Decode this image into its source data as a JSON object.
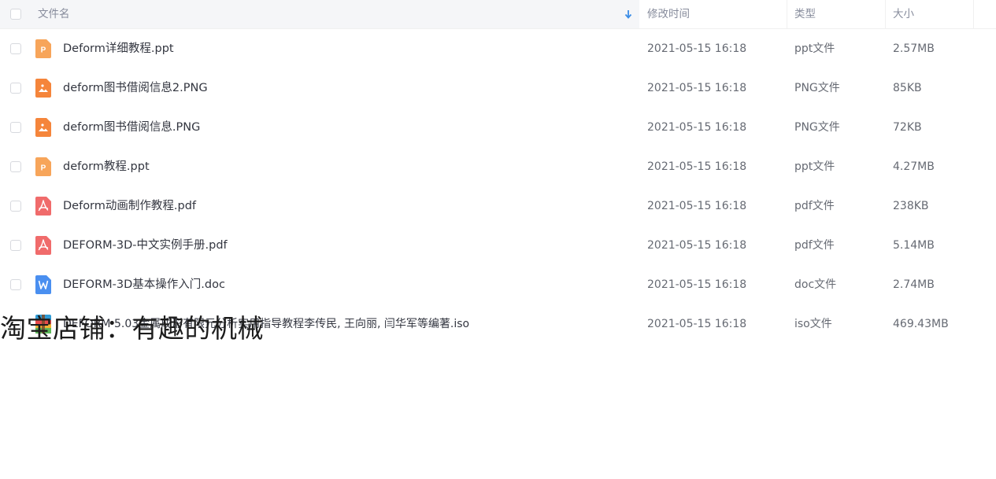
{
  "header": {
    "name_label": "文件名",
    "modified_label": "修改时间",
    "type_label": "类型",
    "size_label": "大小"
  },
  "files": [
    {
      "name": "Deform详细教程.ppt",
      "modified": "2021-05-15 16:18",
      "type": "ppt文件",
      "size": "2.57MB",
      "icon": "ppt-file-icon",
      "icon_color": "#f7a55a"
    },
    {
      "name": "deform图书借阅信息2.PNG",
      "modified": "2021-05-15 16:18",
      "type": "PNG文件",
      "size": "85KB",
      "icon": "image-file-icon",
      "icon_color": "#f5853b"
    },
    {
      "name": "deform图书借阅信息.PNG",
      "modified": "2021-05-15 16:18",
      "type": "PNG文件",
      "size": "72KB",
      "icon": "image-file-icon",
      "icon_color": "#f5853b"
    },
    {
      "name": "deform教程.ppt",
      "modified": "2021-05-15 16:18",
      "type": "ppt文件",
      "size": "4.27MB",
      "icon": "ppt-file-icon",
      "icon_color": "#f7a55a"
    },
    {
      "name": "Deform动画制作教程.pdf",
      "modified": "2021-05-15 16:18",
      "type": "pdf文件",
      "size": "238KB",
      "icon": "pdf-file-icon",
      "icon_color": "#f06b6b"
    },
    {
      "name": "DEFORM-3D-中文实例手册.pdf",
      "modified": "2021-05-15 16:18",
      "type": "pdf文件",
      "size": "5.14MB",
      "icon": "pdf-file-icon",
      "icon_color": "#f06b6b"
    },
    {
      "name": "DEFORM-3D基本操作入门.doc",
      "modified": "2021-05-15 16:18",
      "type": "doc文件",
      "size": "2.74MB",
      "icon": "word-file-icon",
      "icon_color": "#4a8ff0"
    },
    {
      "name": "DEFORM 5.03金属成形有限元分析实用指导教程李传民, 王向丽, 闫华军等编著.iso",
      "modified": "2021-05-15 16:18",
      "type": "iso文件",
      "size": "469.43MB",
      "icon": "archive-file-icon",
      "icon_color": "#2f9bd6"
    }
  ],
  "watermark": "淘宝店铺：有趣的机械",
  "colors": {
    "header_bg": "#f5f6f8",
    "sort_arrow": "#3b8de6",
    "text_primary": "#333640",
    "text_secondary": "#666a73"
  }
}
